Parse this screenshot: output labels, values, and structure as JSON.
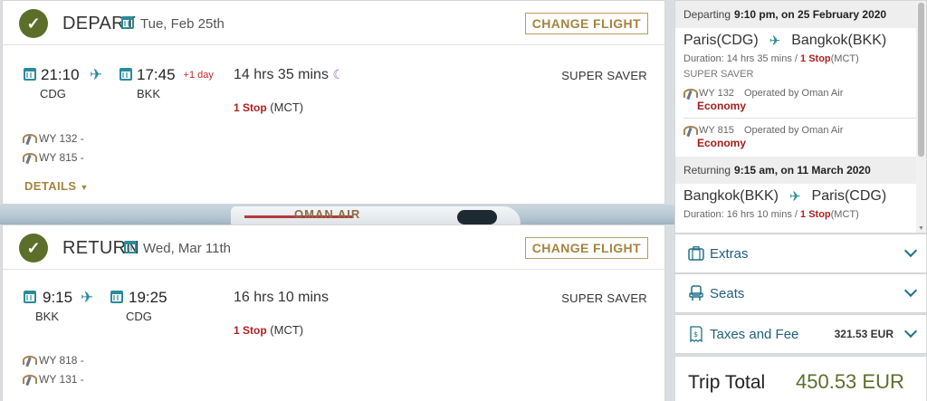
{
  "depart": {
    "title": "DEPART",
    "date": "Tue, Feb 25th",
    "change_label": "CHANGE FLIGHT",
    "dep_time": "21:10",
    "dep_code": "CDG",
    "arr_time": "17:45",
    "arr_code": "BKK",
    "plus_day": "+1 day",
    "duration": "14 hrs 35 mins",
    "stops_count": "1 Stop",
    "stops_via": "(MCT)",
    "fare": "SUPER SAVER",
    "flights": [
      "WY 132 -",
      "WY 815 -"
    ],
    "details_label": "DETAILS"
  },
  "return": {
    "title": "RETURN",
    "date": "Wed, Mar 11th",
    "change_label": "CHANGE FLIGHT",
    "dep_time": "9:15",
    "dep_code": "BKK",
    "arr_time": "19:25",
    "arr_code": "CDG",
    "duration": "16 hrs 10 mins",
    "stops_count": "1 Stop",
    "stops_via": "(MCT)",
    "fare": "SUPER SAVER",
    "flights": [
      "WY 818 -",
      "WY 131 -"
    ]
  },
  "background": {
    "airline_text": "OMAN AIR"
  },
  "summary": {
    "departing": {
      "label": "Departing",
      "when": "9:10 pm, on 25 February 2020",
      "from": "Paris(CDG)",
      "to": "Bangkok(BKK)",
      "duration": "Duration: 14 hrs 35 mins /",
      "stops": "1 Stop",
      "via": "(MCT)",
      "fare": "SUPER SAVER",
      "segments": [
        {
          "flight": "WY 132",
          "operated": "Operated by Oman Air",
          "class": "Economy"
        },
        {
          "flight": "WY 815",
          "operated": "Operated by Oman Air",
          "class": "Economy"
        }
      ]
    },
    "returning": {
      "label": "Returning",
      "when": "9:15 am, on 11 March 2020",
      "from": "Bangkok(BKK)",
      "to": "Paris(CDG)",
      "duration": "Duration: 16 hrs 10 mins /",
      "stops": "1 Stop",
      "via": "(MCT)"
    }
  },
  "extras": {
    "label": "Extras"
  },
  "seats": {
    "label": "Seats"
  },
  "taxes": {
    "label": "Taxes and Fee",
    "price": "321.53 EUR"
  },
  "total": {
    "label": "Trip Total",
    "value": "450.53 EUR"
  },
  "colors": {
    "accent": "#2a8b9a",
    "olive": "#5b6f2b",
    "gold": "#a4843f",
    "red": "#b01f1f"
  }
}
